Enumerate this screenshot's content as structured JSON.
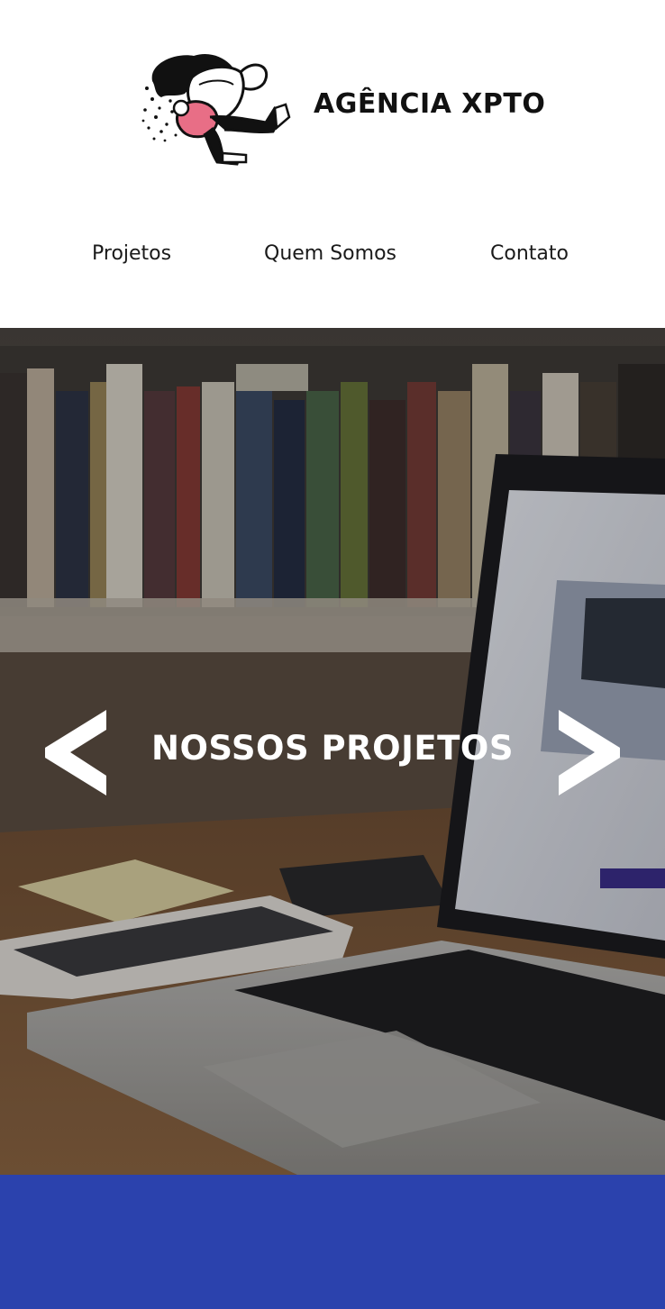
{
  "header": {
    "brand": "AGÊNCIA XPTO",
    "logo_icon": "person-in-teacup-illustration"
  },
  "nav": {
    "items": [
      {
        "label": "Projetos"
      },
      {
        "label": "Quem Somos"
      },
      {
        "label": "Contato"
      }
    ]
  },
  "hero": {
    "title": "NOSSOS PROJETOS",
    "prev_icon": "chevron-left-icon",
    "next_icon": "chevron-right-icon",
    "background": "laptop-on-desk-photo"
  },
  "band": {
    "color": "#2b42ad"
  }
}
